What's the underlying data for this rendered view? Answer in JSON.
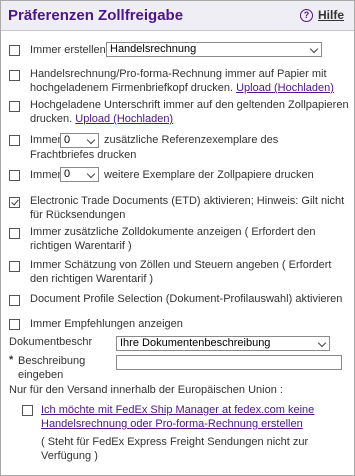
{
  "header": {
    "title": "Präferenzen Zollfreigabe",
    "help_icon": "?",
    "help_label": "Hilfe"
  },
  "rows": {
    "always_create": {
      "label": "Immer erstellen",
      "select_value": "Handelsrechnung",
      "checked": false
    },
    "print_on_paper": {
      "line1": "Handelsrechnung/Pro-forma-Rechnung immer auf Papier mit",
      "line2_text": "hochgeladenem Firmenbriefkopf drucken.",
      "link": "Upload (Hochladen)",
      "checked": false
    },
    "signature": {
      "line1": "Hochgeladene Unterschrift immer auf den geltenden Zollpapieren",
      "line2_text": "drucken.",
      "link": "Upload (Hochladen)",
      "checked": false
    },
    "ref_copies": {
      "prefix": "Immer",
      "select_value": "0",
      "suffix": "zusätzliche Referenzexemplare des",
      "line2": "Frachtbriefes drucken",
      "checked": false
    },
    "customs_copies": {
      "prefix": "Immer",
      "select_value": "0",
      "suffix": "weitere Exemplare der Zollpapiere drucken",
      "checked": false
    },
    "etd": {
      "line1": "Electronic Trade Documents (ETD) aktivieren; Hinweis: Gilt nicht",
      "line2": "für Rücksendungen",
      "checked": true
    },
    "additional_docs": {
      "line1": "Immer zusätzliche Zolldokumente anzeigen ( Erfordert den",
      "line2": "richtigen Warentarif )",
      "checked": false
    },
    "estimate": {
      "line1": "Immer Schätzung von Zöllen und Steuern angeben ( Erfordert",
      "line2": "den richtigen Warentarif )",
      "checked": false
    },
    "doc_profile": {
      "label": "Document Profile Selection (Dokument-Profilauswahl) aktivieren",
      "checked": false
    },
    "recommendations": {
      "label": "Immer Empfehlungen anzeigen",
      "checked": false
    }
  },
  "doc_desc": {
    "label": "Dokumentbeschr",
    "select_value": "Ihre Dokumentenbeschreibung"
  },
  "description": {
    "required_mark": "*",
    "line1": "Beschreibung",
    "line2": "eingeben",
    "value": ""
  },
  "eu_note": "Nur für den Versand innerhalb der Europäischen Union :",
  "fedex": {
    "line1": "Ich möchte mit FedEx Ship Manager at fedex.com keine",
    "line2": "Handelsrechnung oder Pro-forma-Rechnung erstellen",
    "checked": false,
    "note1": "( Steht für FedEx Express Freight Sendungen nicht zur",
    "note2": "Verfügung )"
  }
}
